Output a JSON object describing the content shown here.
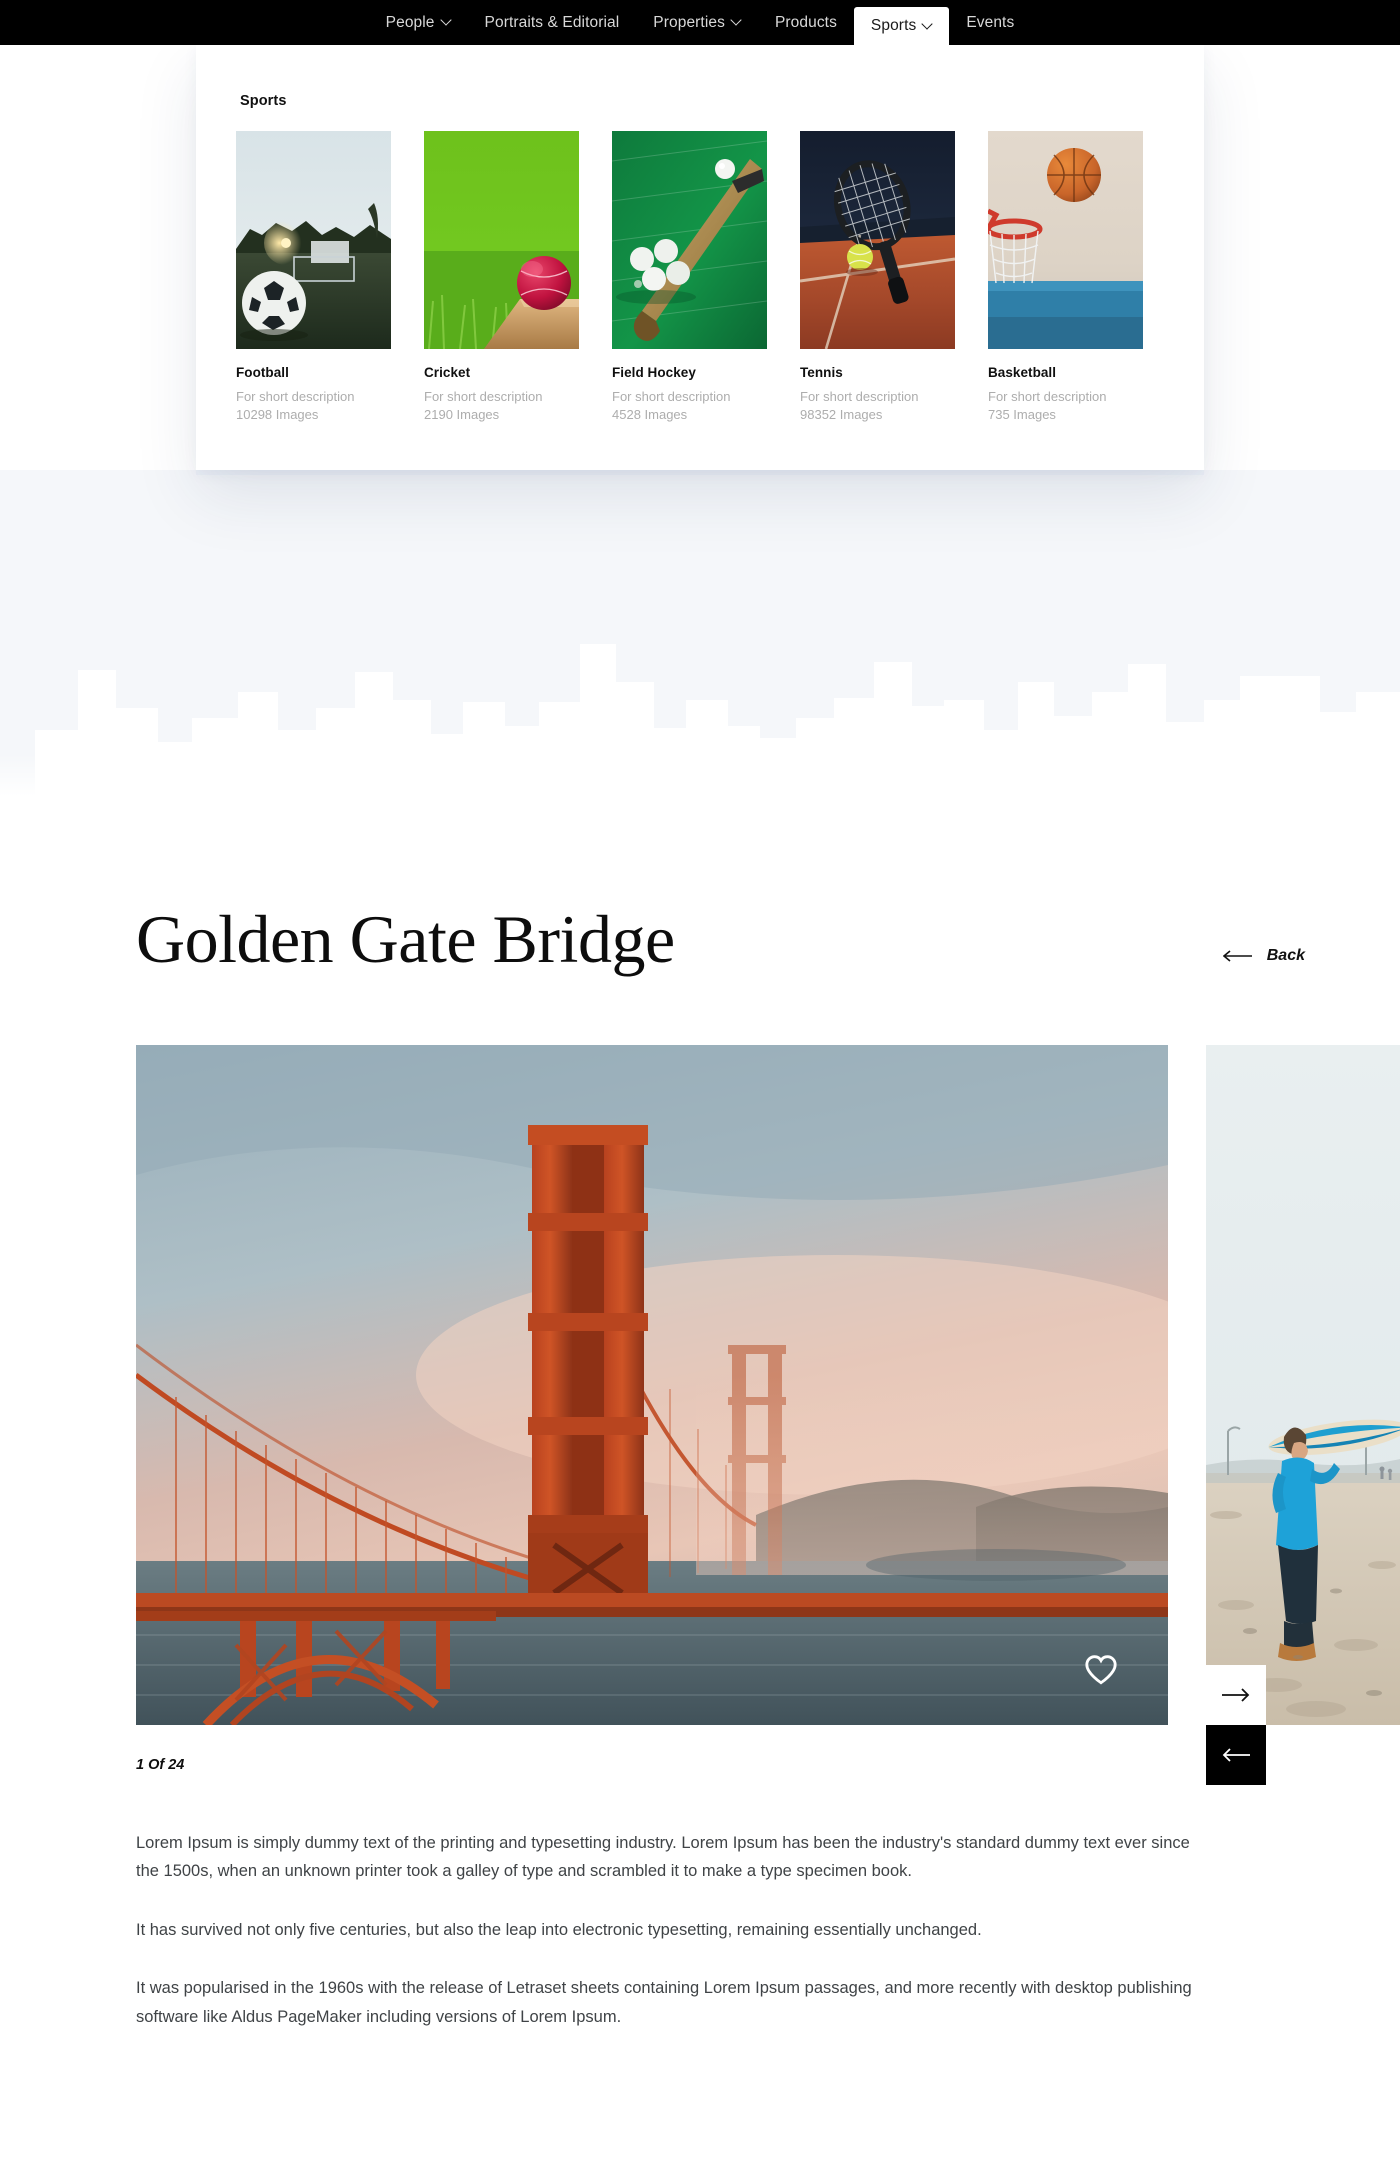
{
  "nav": {
    "items": [
      {
        "label": "People",
        "has_dropdown": true,
        "active": false
      },
      {
        "label": "Portraits & Editorial",
        "has_dropdown": false,
        "active": false
      },
      {
        "label": "Properties",
        "has_dropdown": true,
        "active": false
      },
      {
        "label": "Products",
        "has_dropdown": false,
        "active": false
      },
      {
        "label": "Sports",
        "has_dropdown": true,
        "active": true
      },
      {
        "label": "Events",
        "has_dropdown": false,
        "active": false
      }
    ]
  },
  "mega_menu": {
    "title": "Sports",
    "categories": [
      {
        "name": "Football",
        "description": "For short description",
        "count": "10298 Images",
        "image": "soccer-ball-on-pitch-at-sunset"
      },
      {
        "name": "Cricket",
        "description": "For short description",
        "count": "2190 Images",
        "image": "red-cricket-ball-on-bat-in-grass"
      },
      {
        "name": "Field Hockey",
        "description": "For short description",
        "count": "4528 Images",
        "image": "hockey-stick-and-balls-on-turf"
      },
      {
        "name": "Tennis",
        "description": "For short description",
        "count": "98352 Images",
        "image": "tennis-racket-and-ball-on-clay-court"
      },
      {
        "name": "Basketball",
        "description": "For short description",
        "count": "735 Images",
        "image": "basketball-entering-hoop"
      }
    ]
  },
  "article": {
    "title": "Golden Gate Bridge",
    "back_label": "Back",
    "back_icon": "arrow-left-icon",
    "counter": "1 Of 24",
    "favorite_icon": "heart-outline-icon",
    "next_icon": "arrow-right-icon",
    "prev_icon": "arrow-left-icon",
    "hero_image": "golden-gate-bridge-at-dusk",
    "side_image": "surfer-walking-on-beach",
    "paragraphs": [
      "Lorem Ipsum is simply dummy text of the printing and typesetting industry. Lorem Ipsum has been the industry's standard dummy text ever since the 1500s, when an unknown printer took a galley of type and scrambled it to make a type specimen book.",
      "It has survived not only five centuries, but also the leap into electronic typesetting, remaining essentially unchanged.",
      "It was popularised in the 1960s with the release of Letraset sheets containing Lorem Ipsum passages, and more recently with desktop publishing software like Aldus PageMaker including versions of Lorem Ipsum."
    ]
  },
  "theme": {
    "nav_background": "#000000",
    "page_background": "#ffffff",
    "band_background": "#f5f7fa",
    "muted_text": "#adadad",
    "body_text": "#3f4346"
  }
}
